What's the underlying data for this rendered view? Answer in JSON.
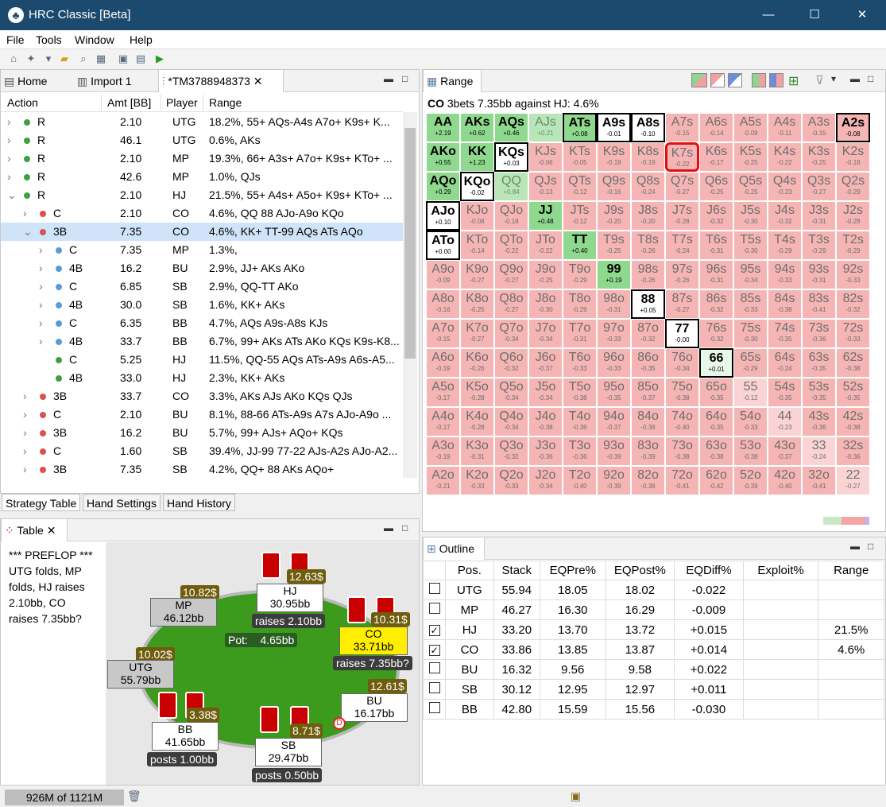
{
  "window": {
    "title": "HRC Classic [Beta]",
    "minimize": "—",
    "maximize": "☐",
    "close": "✕"
  },
  "menu": [
    "File",
    "Tools",
    "Window",
    "Help"
  ],
  "colors": {
    "raise": "#3ea040",
    "call": "#d95252",
    "call_blue": "#5b9bd5",
    "selected": "#cfe4f8"
  },
  "tabs_left": {
    "home": "Home",
    "import": "Import 1",
    "current": "*TM3788948373"
  },
  "tree": {
    "headers": [
      "Action",
      "Amt [BB]",
      "Player",
      "Range"
    ],
    "rows": [
      {
        "expand": ">",
        "dot": "raise",
        "action": "R",
        "amt": "2.10",
        "player": "UTG",
        "range": "18.2%, 55+ AQs-A4s A7o+ K9s+ K..."
      },
      {
        "expand": ">",
        "dot": "raise",
        "action": "R",
        "amt": "46.1",
        "player": "UTG",
        "range": "0.6%, AKs"
      },
      {
        "expand": ">",
        "dot": "raise",
        "action": "R",
        "amt": "2.10",
        "player": "MP",
        "range": "19.3%, 66+ A3s+ A7o+ K9s+ KTo+ ..."
      },
      {
        "expand": ">",
        "dot": "raise",
        "action": "R",
        "amt": "42.6",
        "player": "MP",
        "range": "1.0%, QJs"
      },
      {
        "expand": "v",
        "dot": "raise",
        "action": "R",
        "amt": "2.10",
        "player": "HJ",
        "range": "21.5%, 55+ A4s+ A5o+ K9s+ KTo+ ..."
      },
      {
        "expand": ">",
        "dot": "call",
        "action": "C",
        "amt": "2.10",
        "player": "CO",
        "range": "4.6%, QQ 88 AJo-A9o KQo"
      },
      {
        "expand": "v",
        "dot": "call",
        "action": "3B",
        "amt": "7.35",
        "player": "CO",
        "range": "4.6%, KK+ TT-99 AQs ATs AQo"
      },
      {
        "expand": ">",
        "dot": "call_blue",
        "action": "C",
        "amt": "7.35",
        "player": "MP",
        "range": "1.3%,"
      },
      {
        "expand": ">",
        "dot": "call_blue",
        "action": "4B",
        "amt": "16.2",
        "player": "BU",
        "range": "2.9%, JJ+ AKs AKo"
      },
      {
        "expand": ">",
        "dot": "call_blue",
        "action": "C",
        "amt": "6.85",
        "player": "SB",
        "range": "2.9%, QQ-TT AKo"
      },
      {
        "expand": ">",
        "dot": "call_blue",
        "action": "4B",
        "amt": "30.0",
        "player": "SB",
        "range": "1.6%, KK+ AKs"
      },
      {
        "expand": ">",
        "dot": "call_blue",
        "action": "C",
        "amt": "6.35",
        "player": "BB",
        "range": "4.7%, AQs A9s-A8s KJs"
      },
      {
        "expand": ">",
        "dot": "call_blue",
        "action": "4B",
        "amt": "33.7",
        "player": "BB",
        "range": "6.7%, 99+ AKs ATs AKo KQs K9s-K8..."
      },
      {
        "expand": "",
        "dot": "raise",
        "action": "C",
        "amt": "5.25",
        "player": "HJ",
        "range": "11.5%, QQ-55 AQs ATs-A9s A6s-A5..."
      },
      {
        "expand": "",
        "dot": "raise",
        "action": "4B",
        "amt": "33.0",
        "player": "HJ",
        "range": "2.3%, KK+ AKs"
      },
      {
        "expand": ">",
        "dot": "call",
        "action": "3B",
        "amt": "33.7",
        "player": "CO",
        "range": "3.3%, AKs AJs AKo KQs QJs"
      },
      {
        "expand": ">",
        "dot": "call",
        "action": "C",
        "amt": "2.10",
        "player": "BU",
        "range": "8.1%, 88-66 ATs-A9s A7s AJo-A9o ..."
      },
      {
        "expand": ">",
        "dot": "call",
        "action": "3B",
        "amt": "16.2",
        "player": "BU",
        "range": "5.7%, 99+ AJs+ AQo+ KQs"
      },
      {
        "expand": ">",
        "dot": "call",
        "action": "C",
        "amt": "1.60",
        "player": "SB",
        "range": "39.4%, JJ-99 77-22 AJs-A2s AJo-A2..."
      },
      {
        "expand": ">",
        "dot": "call",
        "action": "3B",
        "amt": "7.35",
        "player": "SB",
        "range": "4.2%, QQ+ 88 AKs AQo+"
      }
    ]
  },
  "bottom_tabs": [
    "Strategy Table",
    "Hand Settings",
    "Hand History"
  ],
  "table_pane": {
    "tab": "Table",
    "history": [
      "*** PREFLOP ***",
      "UTG folds, MP",
      "folds, HJ raises",
      "2.10bb, CO",
      "raises 7.35bb?"
    ],
    "pot_label": "Pot:",
    "pot_value": "4.65bb",
    "seats": {
      "hj": {
        "name": "HJ",
        "stack": "30.95bb",
        "chip": "12.63$",
        "action": "raises 2.10bb"
      },
      "mp": {
        "name": "MP",
        "stack": "46.12bb",
        "chip": "10.82$"
      },
      "co": {
        "name": "CO",
        "stack": "33.71bb",
        "chip": "10.31$",
        "action": "raises 7.35bb?"
      },
      "utg": {
        "name": "UTG",
        "stack": "55.79bb",
        "chip": "10.02$"
      },
      "bu": {
        "name": "BU",
        "stack": "16.17bb",
        "chip": "12.61$"
      },
      "bb": {
        "name": "BB",
        "stack": "41.65bb",
        "chip": "3.38$",
        "action": "posts 1.00bb"
      },
      "sb": {
        "name": "SB",
        "stack": "29.47bb",
        "chip": "8.71$",
        "action": "posts 0.50bb"
      }
    }
  },
  "range_pane": {
    "tab": "Range",
    "heading_pos": "CO",
    "heading": "3bets 7.35bb against HJ: 4.6%",
    "grid": [
      [
        [
          "AA",
          "+2.19",
          "g"
        ],
        [
          "AKs",
          "+0.62",
          "g"
        ],
        [
          "AQs",
          "+0.46",
          "g"
        ],
        [
          "AJs",
          "+0.21",
          "lg"
        ],
        [
          "ATs",
          "+0.08",
          "gb"
        ],
        [
          "A9s",
          "-0.01",
          "wb"
        ],
        [
          "A8s",
          "-0.10",
          "wb"
        ],
        [
          "A7s",
          "-0.15",
          "p"
        ],
        [
          "A6s",
          "-0.14",
          "p"
        ],
        [
          "A5s",
          "-0.09",
          "p"
        ],
        [
          "A4s",
          "-0.11",
          "p"
        ],
        [
          "A3s",
          "-0.15",
          "p"
        ],
        [
          "A2s",
          "-0.08",
          "wbp"
        ]
      ],
      [
        [
          "AKo",
          "+0.55",
          "g"
        ],
        [
          "KK",
          "+1.23",
          "g"
        ],
        [
          "KQs",
          "+0.03",
          "wb"
        ],
        [
          "KJs",
          "-0.06",
          "p"
        ],
        [
          "KTs",
          "-0.05",
          "p"
        ],
        [
          "K9s",
          "-0.19",
          "p"
        ],
        [
          "K8s",
          "-0.19",
          "p"
        ],
        [
          "K7s",
          "-0.22",
          "p"
        ],
        [
          "K6s",
          "-0.17",
          "p"
        ],
        [
          "K5s",
          "-0.25",
          "p"
        ],
        [
          "K4s",
          "-0.22",
          "p"
        ],
        [
          "K3s",
          "-0.25",
          "p"
        ],
        [
          "K2s",
          "-0.18",
          "p"
        ]
      ],
      [
        [
          "AQo",
          "+0.29",
          "g"
        ],
        [
          "KQo",
          "-0.02",
          "wb"
        ],
        [
          "QQ",
          "+0.84",
          "lg"
        ],
        [
          "QJs",
          "-0.13",
          "p"
        ],
        [
          "QTs",
          "-0.12",
          "p"
        ],
        [
          "Q9s",
          "-0.16",
          "p"
        ],
        [
          "Q8s",
          "-0.24",
          "p"
        ],
        [
          "Q7s",
          "-0.27",
          "p"
        ],
        [
          "Q6s",
          "-0.25",
          "p"
        ],
        [
          "Q5s",
          "-0.25",
          "p"
        ],
        [
          "Q4s",
          "-0.23",
          "p"
        ],
        [
          "Q3s",
          "-0.27",
          "p"
        ],
        [
          "Q2s",
          "-0.29",
          "p"
        ]
      ],
      [
        [
          "AJo",
          "+0.10",
          "wb"
        ],
        [
          "KJo",
          "-0.08",
          "p"
        ],
        [
          "QJo",
          "-0.18",
          "p"
        ],
        [
          "JJ",
          "+0.48",
          "g"
        ],
        [
          "JTs",
          "-0.12",
          "p"
        ],
        [
          "J9s",
          "-0.20",
          "p"
        ],
        [
          "J8s",
          "-0.20",
          "p"
        ],
        [
          "J7s",
          "-0.28",
          "p"
        ],
        [
          "J6s",
          "-0.32",
          "p"
        ],
        [
          "J5s",
          "-0.30",
          "p"
        ],
        [
          "J4s",
          "-0.32",
          "p"
        ],
        [
          "J3s",
          "-0.31",
          "p"
        ],
        [
          "J2s",
          "-0.28",
          "p"
        ]
      ],
      [
        [
          "ATo",
          "+0.00",
          "wb"
        ],
        [
          "KTo",
          "-0.14",
          "p"
        ],
        [
          "QTo",
          "-0.22",
          "p"
        ],
        [
          "JTo",
          "-0.22",
          "p"
        ],
        [
          "TT",
          "+0.40",
          "g"
        ],
        [
          "T9s",
          "-0.25",
          "p"
        ],
        [
          "T8s",
          "-0.26",
          "p"
        ],
        [
          "T7s",
          "-0.24",
          "p"
        ],
        [
          "T6s",
          "-0.31",
          "p"
        ],
        [
          "T5s",
          "-0.30",
          "p"
        ],
        [
          "T4s",
          "-0.29",
          "p"
        ],
        [
          "T3s",
          "-0.29",
          "p"
        ],
        [
          "T2s",
          "-0.29",
          "p"
        ]
      ],
      [
        [
          "A9o",
          "-0.09",
          "p"
        ],
        [
          "K9o",
          "-0.27",
          "p"
        ],
        [
          "Q9o",
          "-0.27",
          "p"
        ],
        [
          "J9o",
          "-0.25",
          "p"
        ],
        [
          "T9o",
          "-0.29",
          "p"
        ],
        [
          "99",
          "+0.19",
          "g"
        ],
        [
          "98s",
          "-0.26",
          "p"
        ],
        [
          "97s",
          "-0.26",
          "p"
        ],
        [
          "96s",
          "-0.31",
          "p"
        ],
        [
          "95s",
          "-0.34",
          "p"
        ],
        [
          "94s",
          "-0.33",
          "p"
        ],
        [
          "93s",
          "-0.31",
          "p"
        ],
        [
          "92s",
          "-0.33",
          "p"
        ]
      ],
      [
        [
          "A8o",
          "-0.16",
          "p"
        ],
        [
          "K8o",
          "-0.25",
          "p"
        ],
        [
          "Q8o",
          "-0.27",
          "p"
        ],
        [
          "J8o",
          "-0.30",
          "p"
        ],
        [
          "T8o",
          "-0.29",
          "p"
        ],
        [
          "98o",
          "-0.31",
          "p"
        ],
        [
          "88",
          "+0.05",
          "wb"
        ],
        [
          "87s",
          "-0.27",
          "p"
        ],
        [
          "86s",
          "-0.32",
          "p"
        ],
        [
          "85s",
          "-0.33",
          "p"
        ],
        [
          "84s",
          "-0.38",
          "p"
        ],
        [
          "83s",
          "-0.41",
          "p"
        ],
        [
          "82s",
          "-0.32",
          "p"
        ]
      ],
      [
        [
          "A7o",
          "-0.15",
          "p"
        ],
        [
          "K7o",
          "-0.27",
          "p"
        ],
        [
          "Q7o",
          "-0.34",
          "p"
        ],
        [
          "J7o",
          "-0.34",
          "p"
        ],
        [
          "T7o",
          "-0.31",
          "p"
        ],
        [
          "97o",
          "-0.33",
          "p"
        ],
        [
          "87o",
          "-0.32",
          "p"
        ],
        [
          "77",
          "-0.00",
          "wb"
        ],
        [
          "76s",
          "-0.32",
          "p"
        ],
        [
          "75s",
          "-0.30",
          "p"
        ],
        [
          "74s",
          "-0.35",
          "p"
        ],
        [
          "73s",
          "-0.36",
          "p"
        ],
        [
          "72s",
          "-0.33",
          "p"
        ]
      ],
      [
        [
          "A6o",
          "-0.19",
          "p"
        ],
        [
          "K6o",
          "-0.26",
          "p"
        ],
        [
          "Q6o",
          "-0.32",
          "p"
        ],
        [
          "J6o",
          "-0.37",
          "p"
        ],
        [
          "T6o",
          "-0.33",
          "p"
        ],
        [
          "96o",
          "-0.33",
          "p"
        ],
        [
          "86o",
          "-0.35",
          "p"
        ],
        [
          "76o",
          "-0.34",
          "p"
        ],
        [
          "66",
          "+0.01",
          "wbg"
        ],
        [
          "65s",
          "-0.29",
          "p"
        ],
        [
          "64s",
          "-0.24",
          "p"
        ],
        [
          "63s",
          "-0.35",
          "p"
        ],
        [
          "62s",
          "-0.38",
          "p"
        ]
      ],
      [
        [
          "A5o",
          "-0.17",
          "p"
        ],
        [
          "K5o",
          "-0.28",
          "p"
        ],
        [
          "Q5o",
          "-0.34",
          "p"
        ],
        [
          "J5o",
          "-0.34",
          "p"
        ],
        [
          "T5o",
          "-0.38",
          "p"
        ],
        [
          "95o",
          "-0.35",
          "p"
        ],
        [
          "85o",
          "-0.37",
          "p"
        ],
        [
          "75o",
          "-0.38",
          "p"
        ],
        [
          "65o",
          "-0.35",
          "p"
        ],
        [
          "55",
          "-0.12",
          "lp"
        ],
        [
          "54s",
          "-0.35",
          "p"
        ],
        [
          "53s",
          "-0.35",
          "p"
        ],
        [
          "52s",
          "-0.35",
          "p"
        ]
      ],
      [
        [
          "A4o",
          "-0.17",
          "p"
        ],
        [
          "K4o",
          "-0.28",
          "p"
        ],
        [
          "Q4o",
          "-0.34",
          "p"
        ],
        [
          "J4o",
          "-0.38",
          "p"
        ],
        [
          "T4o",
          "-0.36",
          "p"
        ],
        [
          "94o",
          "-0.37",
          "p"
        ],
        [
          "84o",
          "-0.36",
          "p"
        ],
        [
          "74o",
          "-0.40",
          "p"
        ],
        [
          "64o",
          "-0.35",
          "p"
        ],
        [
          "54o",
          "-0.33",
          "p"
        ],
        [
          "44",
          "-0.23",
          "lp"
        ],
        [
          "43s",
          "-0.36",
          "p"
        ],
        [
          "42s",
          "-0.38",
          "p"
        ]
      ],
      [
        [
          "A3o",
          "-0.19",
          "p"
        ],
        [
          "K3o",
          "-0.31",
          "p"
        ],
        [
          "Q3o",
          "-0.32",
          "p"
        ],
        [
          "J3o",
          "-0.36",
          "p"
        ],
        [
          "T3o",
          "-0.36",
          "p"
        ],
        [
          "93o",
          "-0.39",
          "p"
        ],
        [
          "83o",
          "-0.39",
          "p"
        ],
        [
          "73o",
          "-0.38",
          "p"
        ],
        [
          "63o",
          "-0.38",
          "p"
        ],
        [
          "53o",
          "-0.38",
          "p"
        ],
        [
          "43o",
          "-0.37",
          "p"
        ],
        [
          "33",
          "-0.24",
          "lp"
        ],
        [
          "32s",
          "-0.36",
          "p"
        ]
      ],
      [
        [
          "A2o",
          "-0.21",
          "p"
        ],
        [
          "K2o",
          "-0.33",
          "p"
        ],
        [
          "Q2o",
          "-0.33",
          "p"
        ],
        [
          "J2o",
          "-0.34",
          "p"
        ],
        [
          "T2o",
          "-0.40",
          "p"
        ],
        [
          "92o",
          "-0.39",
          "p"
        ],
        [
          "82o",
          "-0.38",
          "p"
        ],
        [
          "72o",
          "-0.41",
          "p"
        ],
        [
          "62o",
          "-0.42",
          "p"
        ],
        [
          "52o",
          "-0.39",
          "p"
        ],
        [
          "42o",
          "-0.40",
          "p"
        ],
        [
          "32o",
          "-0.41",
          "p"
        ],
        [
          "22",
          "-0.27",
          "lp"
        ]
      ]
    ]
  },
  "outline": {
    "tab": "Outline",
    "headers": [
      "",
      "Pos.",
      "Stack",
      "EQPre%",
      "EQPost%",
      "EQDiff%",
      "Exploit%",
      "Range"
    ],
    "rows": [
      {
        "checked": false,
        "pos": "UTG",
        "stack": "55.94",
        "eqpre": "18.05",
        "eqpost": "18.02",
        "eqdiff": "-0.022",
        "exploit": "",
        "range": ""
      },
      {
        "checked": false,
        "pos": "MP",
        "stack": "46.27",
        "eqpre": "16.30",
        "eqpost": "16.29",
        "eqdiff": "-0.009",
        "exploit": "",
        "range": ""
      },
      {
        "checked": true,
        "pos": "HJ",
        "stack": "33.20",
        "eqpre": "13.70",
        "eqpost": "13.72",
        "eqdiff": "+0.015",
        "exploit": "",
        "range": "21.5%"
      },
      {
        "checked": true,
        "pos": "CO",
        "stack": "33.86",
        "eqpre": "13.85",
        "eqpost": "13.87",
        "eqdiff": "+0.014",
        "exploit": "",
        "range": "4.6%"
      },
      {
        "checked": false,
        "pos": "BU",
        "stack": "16.32",
        "eqpre": "9.56",
        "eqpost": "9.58",
        "eqdiff": "+0.022",
        "exploit": "",
        "range": ""
      },
      {
        "checked": false,
        "pos": "SB",
        "stack": "30.12",
        "eqpre": "12.95",
        "eqpost": "12.97",
        "eqdiff": "+0.011",
        "exploit": "",
        "range": ""
      },
      {
        "checked": false,
        "pos": "BB",
        "stack": "42.80",
        "eqpre": "15.59",
        "eqpost": "15.56",
        "eqdiff": "-0.030",
        "exploit": "",
        "range": ""
      }
    ]
  },
  "status": {
    "memory": "926M of 1121M"
  }
}
